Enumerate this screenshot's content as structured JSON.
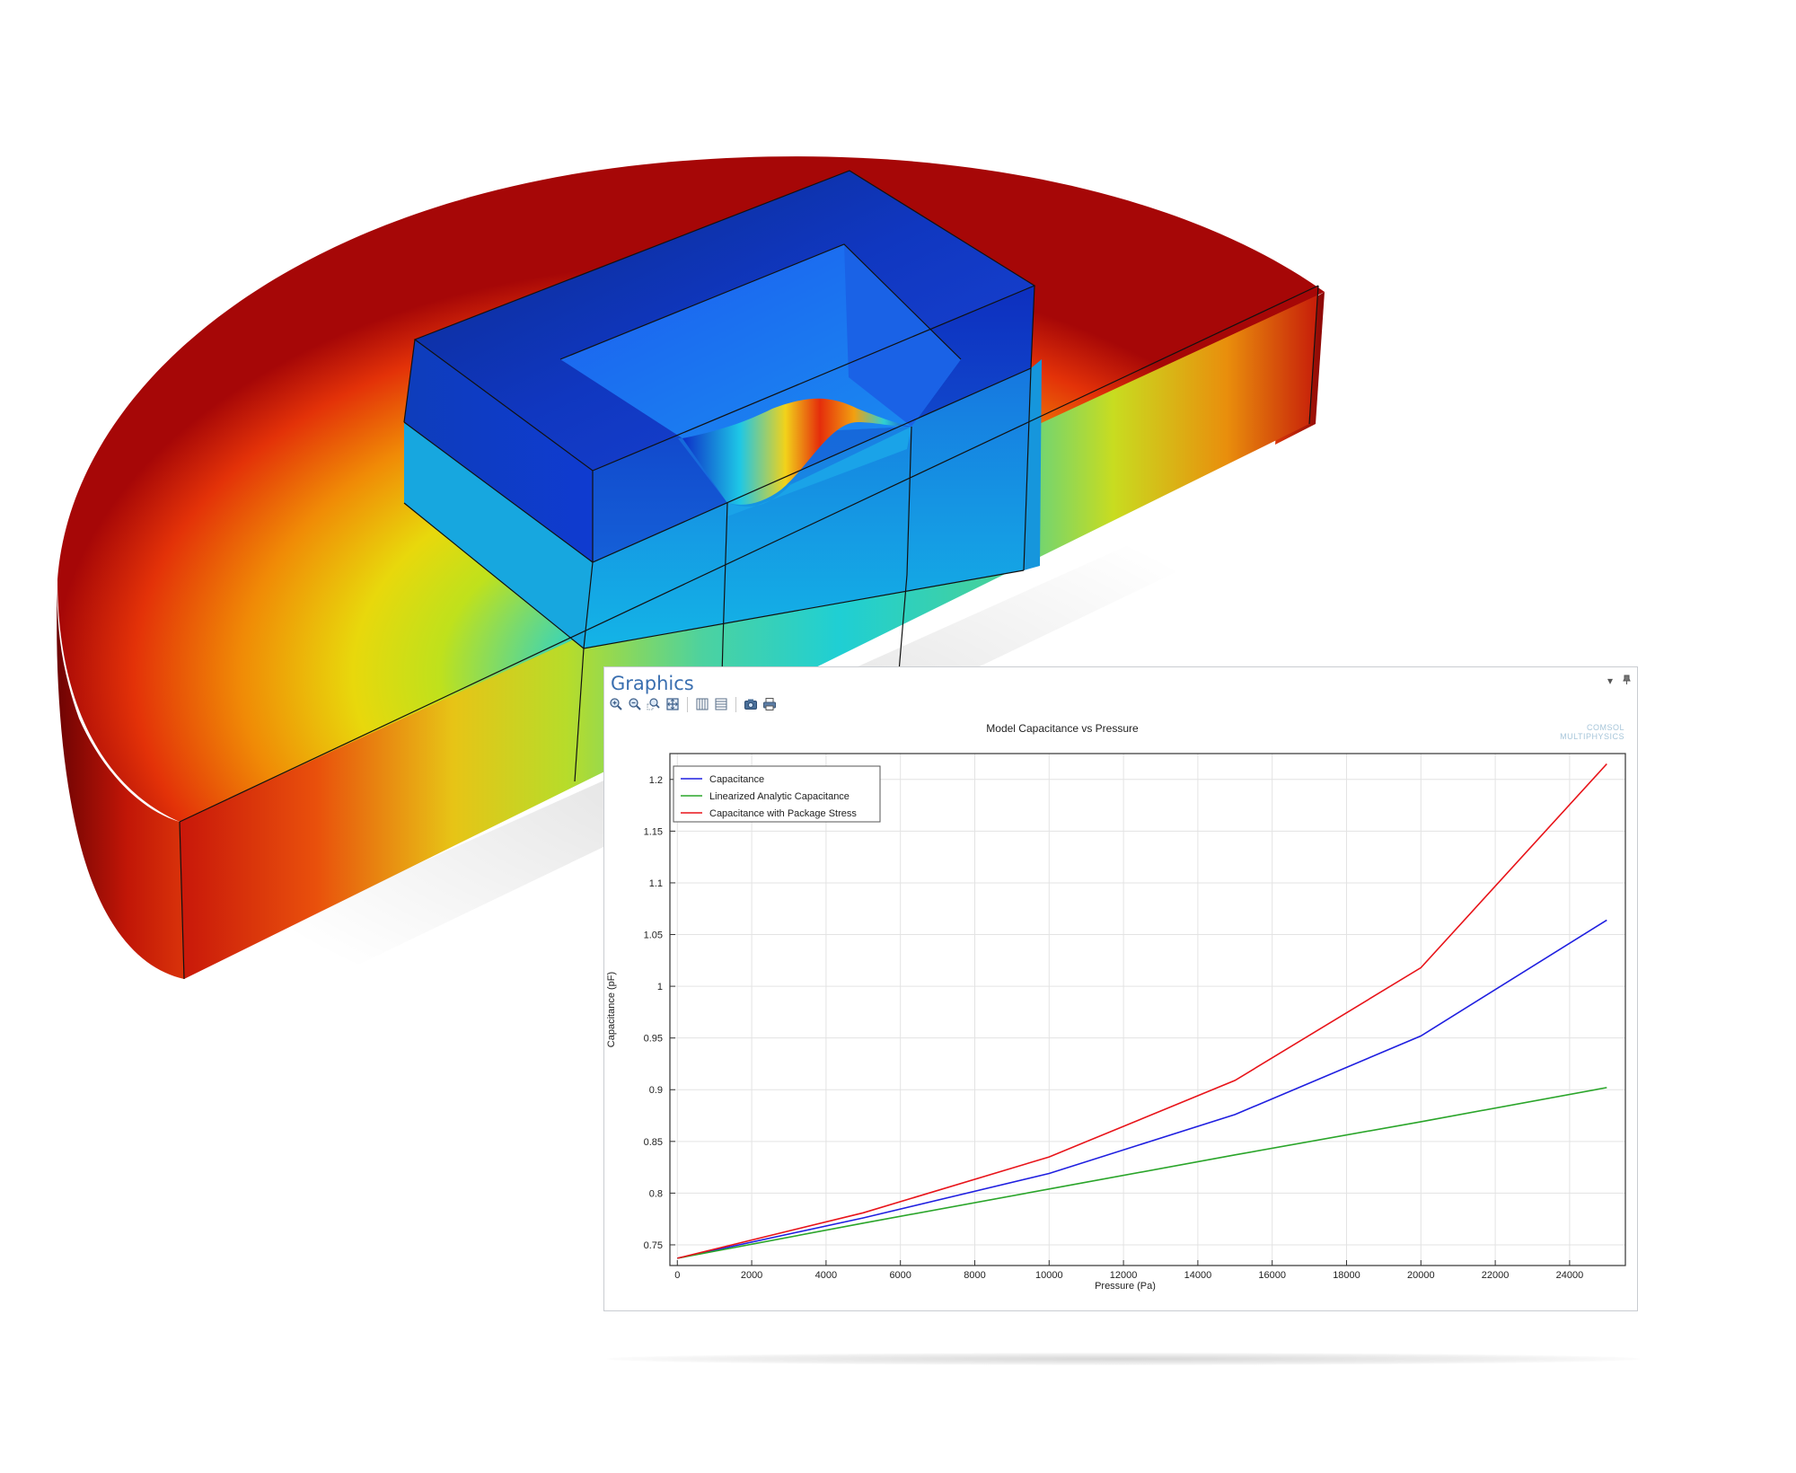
{
  "panel": {
    "title": "Graphics",
    "toolbar": [
      {
        "name": "zoom-in-icon"
      },
      {
        "name": "zoom-out-icon"
      },
      {
        "name": "zoom-box-icon"
      },
      {
        "name": "zoom-extents-icon"
      },
      {
        "name": "grid-columns-icon"
      },
      {
        "name": "grid-rows-icon"
      },
      {
        "name": "camera-icon"
      },
      {
        "name": "print-icon"
      }
    ],
    "header_controls": [
      {
        "name": "dropdown-icon",
        "glyph": "▾"
      },
      {
        "name": "pin-icon",
        "glyph": "🖈"
      }
    ],
    "watermark": [
      "COMSOL",
      "MULTIPHYSICS"
    ]
  },
  "colors": {
    "capacitance": "#1f1fe0",
    "linearized": "#2aa52a",
    "package_stress": "#e8141a",
    "panel_title": "#3a6fb0"
  },
  "chart_data": {
    "type": "line",
    "title": "Model Capacitance vs Pressure",
    "xlabel": "Pressure (Pa)",
    "ylabel": "Capacitance (pF)",
    "xlim": [
      -200,
      25500
    ],
    "ylim": [
      0.73,
      1.225
    ],
    "grid": true,
    "legend_position": "top-left",
    "xticks": [
      0,
      2000,
      4000,
      6000,
      8000,
      10000,
      12000,
      14000,
      16000,
      18000,
      20000,
      22000,
      24000
    ],
    "yticks": [
      0.75,
      0.8,
      0.85,
      0.9,
      0.95,
      1,
      1.05,
      1.1,
      1.15,
      1.2
    ],
    "x": [
      0,
      5000,
      10000,
      15000,
      20000,
      25000
    ],
    "series": [
      {
        "name": "Capacitance",
        "color": "#1f1fe0",
        "values": [
          0.737,
          0.776,
          0.819,
          0.876,
          0.952,
          1.064
        ]
      },
      {
        "name": "Linearized Analytic Capacitance",
        "color": "#2aa52a",
        "values": [
          0.737,
          0.771,
          0.804,
          0.837,
          0.869,
          0.902
        ]
      },
      {
        "name": "Capacitance with Package Stress",
        "color": "#e8141a",
        "values": [
          0.737,
          0.781,
          0.835,
          0.909,
          1.018,
          1.215
        ]
      }
    ]
  }
}
